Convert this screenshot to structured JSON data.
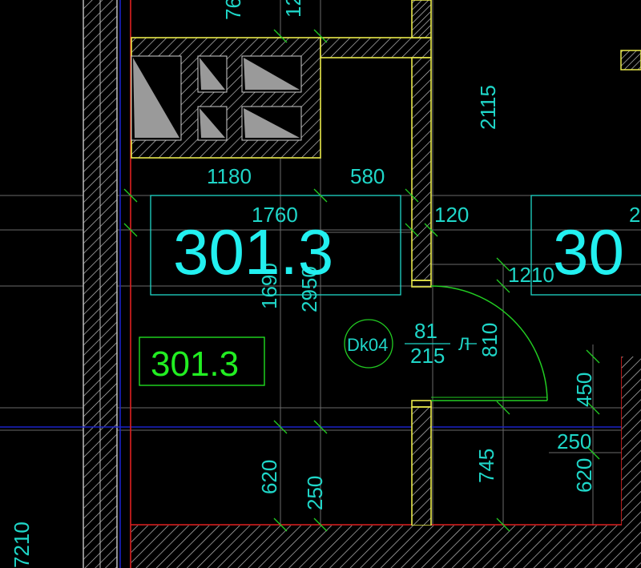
{
  "colors": {
    "background": "#000000",
    "wall_outline": "#e8e84a",
    "hatch": "#bdbdbd",
    "dimension": "#1fd6c8",
    "room_label": "#22f0f0",
    "room_tag": "#22ee22",
    "axis_blue": "#1a22c8",
    "slab_red": "#e02020",
    "door_arc": "#22cc22",
    "grid_gray": "#6a6a6a"
  },
  "room": {
    "label_main": "301.3",
    "label_right_partial": "30",
    "tag": "301.3",
    "top_right_partial": "2"
  },
  "door": {
    "code": "Dk04",
    "width": "81",
    "height": "215",
    "side": "Л"
  },
  "dimensions": {
    "top_76": "76",
    "top_12": "12",
    "d2115": "2115",
    "d1180": "1180",
    "d580": "580",
    "d1760": "1760",
    "d120": "120",
    "d1690": "1690",
    "d2950": "2950",
    "d1210": "1210",
    "d810": "810",
    "d450": "450",
    "d250_right": "250",
    "d620_right": "620",
    "d745": "745",
    "d620_left": "620",
    "d250_bottom": "250",
    "d7210": "7210"
  }
}
